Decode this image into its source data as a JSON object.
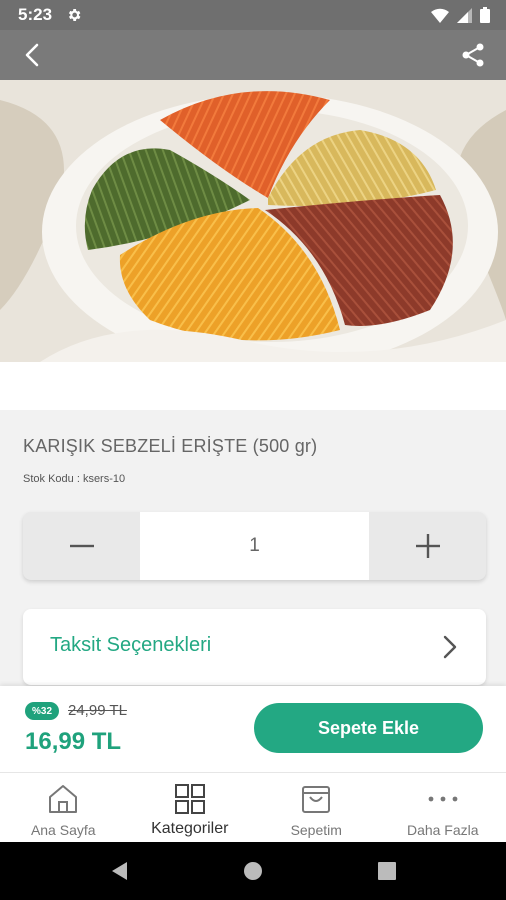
{
  "status_bar": {
    "time": "5:23"
  },
  "product": {
    "title": "KARIŞIK SEBZELİ ERİŞTE (500 gr)",
    "stock_label": "Stok Kodu :",
    "stock_code": "ksers-10"
  },
  "quantity": {
    "value": "1"
  },
  "installment": {
    "label": "Taksit Seçenekleri"
  },
  "price": {
    "discount_badge": "%32",
    "old_price": "24,99 TL",
    "new_price": "16,99 TL",
    "add_to_cart": "Sepete Ekle"
  },
  "bottom_nav": {
    "items": [
      {
        "label": "Ana Sayfa",
        "icon": "home-icon"
      },
      {
        "label": "Kategoriler",
        "icon": "grid-icon"
      },
      {
        "label": "Sepetim",
        "icon": "bag-icon"
      },
      {
        "label": "Daha Fazla",
        "icon": "more-dots-icon"
      }
    ]
  },
  "colors": {
    "accent": "#23a883",
    "price_green": "#1fa27c",
    "app_bar": "#7a7a7a",
    "background": "#f2f2f2"
  }
}
